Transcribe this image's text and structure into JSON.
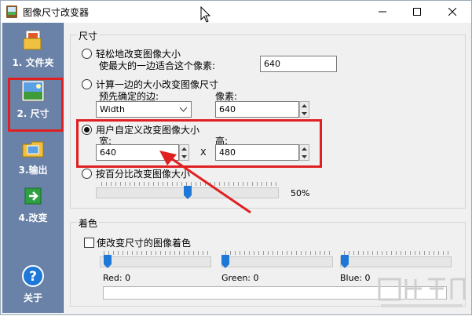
{
  "window": {
    "title": "图像尺寸改变器",
    "controls": [
      "minimize",
      "maximize",
      "close"
    ]
  },
  "sidebar": {
    "items": [
      {
        "label": "1. 文件夹",
        "icon": "folder-files-icon",
        "selected": false
      },
      {
        "label": "2. 尺寸",
        "icon": "resize-picture-icon",
        "selected": true
      },
      {
        "label": "3.输出",
        "icon": "output-folder-icon",
        "selected": false
      },
      {
        "label": "4.改变",
        "icon": "green-arrow-icon",
        "selected": false
      },
      {
        "label": "关于",
        "icon": "help-icon",
        "selected": false
      }
    ]
  },
  "size_group": {
    "title": "尺寸",
    "option1": {
      "label": "轻松地改变图像大小",
      "sub": "使最大的一边适合这个像素:",
      "value": "640"
    },
    "option2": {
      "label": "计算一边的大小改变图像尺寸",
      "edge_label": "预先确定的边:",
      "edge_value": "Width",
      "pixels_label": "像素:",
      "pixels_value": "640"
    },
    "option3": {
      "label": "用户自定义改变图像大小",
      "width_label": "宽:",
      "width_value": "640",
      "x_label": "X",
      "height_label": "高:",
      "height_value": "480",
      "selected": true
    },
    "option4": {
      "label": "按百分比改变图像大小",
      "percent": "50%",
      "slider_fraction": 0.5
    }
  },
  "color_group": {
    "title": "着色",
    "checkbox_label": "使改变尺寸的图像着色",
    "red_label": "Red: 0",
    "green_label": "Green: 0",
    "blue_label": "Blue: 0"
  },
  "colors": {
    "sidebar_bg": "#6a82a7",
    "highlight_red": "#e02020",
    "accent_blue": "#1e78d7"
  }
}
